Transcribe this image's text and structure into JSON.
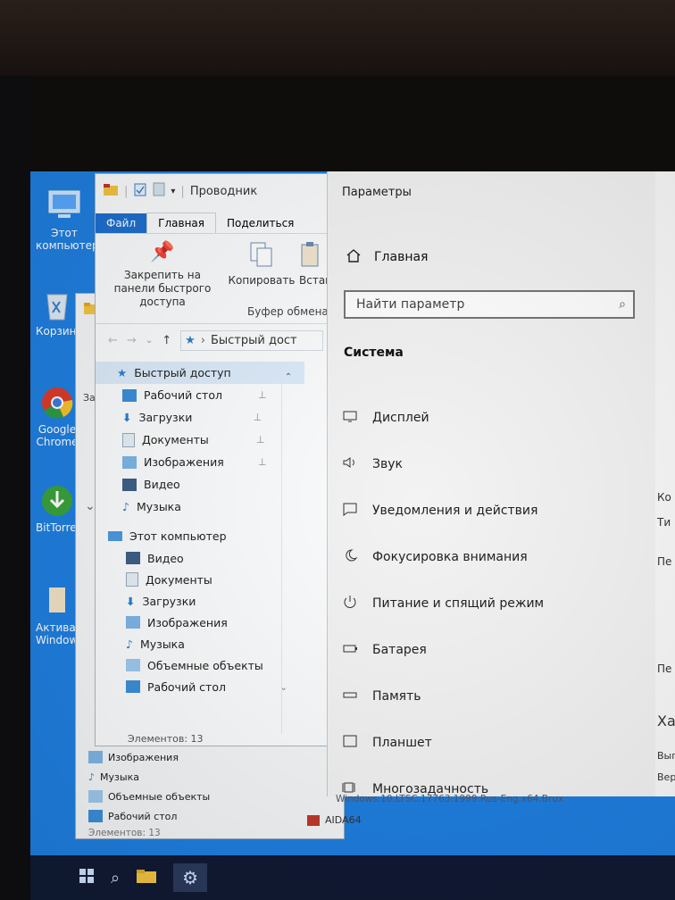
{
  "desktop": {
    "icons": [
      {
        "label": "Этот компьютер"
      },
      {
        "label": "Корзина"
      },
      {
        "label": "Google Chrome"
      },
      {
        "label": "BitTorrent"
      },
      {
        "label": "Активация Windows"
      }
    ]
  },
  "explorer_back": {
    "title": "Проводник",
    "partial_left": "Закр",
    "tree": [
      {
        "label": "Изображения"
      },
      {
        "label": "Музыка"
      },
      {
        "label": "Объемные объекты"
      },
      {
        "label": "Рабочий стол"
      }
    ],
    "status": "Элементов: 13"
  },
  "explorer": {
    "title": "Проводник",
    "tabs": [
      "Файл",
      "Главная",
      "Поделиться"
    ],
    "ribbon": {
      "pin_label": "Закрепить на панели быстрого доступа",
      "copy_label": "Копировать",
      "paste_label": "Встав",
      "group_label": "Буфер обмена"
    },
    "address": "Быстрый дост",
    "quick_access": {
      "label": "Быстрый доступ",
      "items": [
        {
          "label": "Рабочий стол",
          "pinned": true
        },
        {
          "label": "Загрузки",
          "pinned": true
        },
        {
          "label": "Документы",
          "pinned": true
        },
        {
          "label": "Изображения",
          "pinned": true
        },
        {
          "label": "Видео",
          "pinned": false
        },
        {
          "label": "Музыка",
          "pinned": false
        }
      ]
    },
    "this_pc": {
      "label": "Этот компьютер",
      "items": [
        {
          "label": "Видео"
        },
        {
          "label": "Документы"
        },
        {
          "label": "Загрузки"
        },
        {
          "label": "Изображения"
        },
        {
          "label": "Музыка"
        },
        {
          "label": "Объемные объекты"
        },
        {
          "label": "Рабочий стол"
        }
      ]
    },
    "status": "Элементов: 13"
  },
  "settings": {
    "title": "Параметры",
    "home_label": "Главная",
    "search_placeholder": "Найти параметр",
    "section": "Система",
    "items": [
      {
        "label": "Дисплей",
        "icon": "monitor-icon"
      },
      {
        "label": "Звук",
        "icon": "speaker-icon"
      },
      {
        "label": "Уведомления и действия",
        "icon": "notification-icon"
      },
      {
        "label": "Фокусировка внимания",
        "icon": "moon-icon"
      },
      {
        "label": "Питание и спящий режим",
        "icon": "power-icon"
      },
      {
        "label": "Батарея",
        "icon": "battery-icon"
      },
      {
        "label": "Память",
        "icon": "storage-icon"
      },
      {
        "label": "Планшет",
        "icon": "tablet-icon"
      },
      {
        "label": "Многозадачность",
        "icon": "multitask-icon"
      }
    ],
    "right_pane": [
      "Хар",
      "Выпу",
      "Верси",
      "Пе",
      "Пе",
      "Ко",
      "Ти"
    ]
  },
  "watermark": "Windows.10.LTSC.17763.1999.Rus-Eng.x64.Brux",
  "aida_label": "AIDA64",
  "colors": {
    "accent": "#1e6fcf",
    "desktop": "#1f7fe0",
    "taskbar": "#101a33"
  }
}
